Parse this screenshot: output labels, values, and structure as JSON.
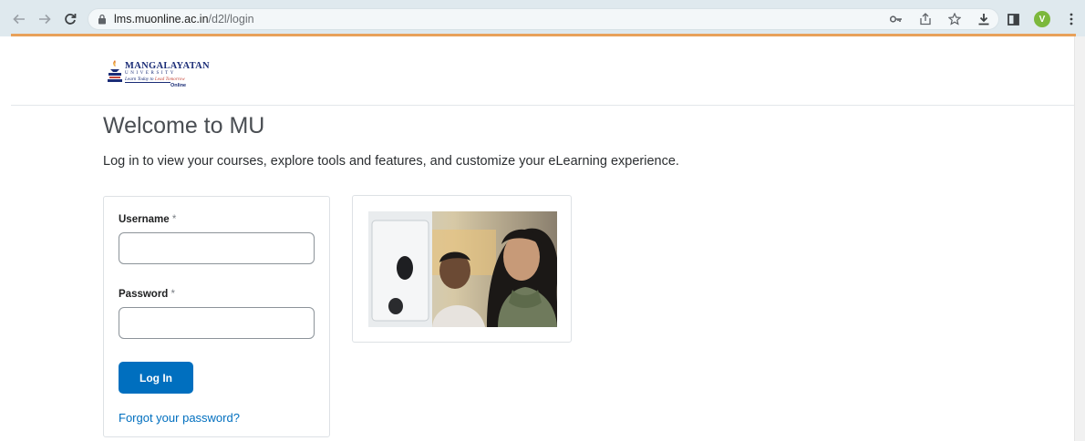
{
  "browser": {
    "url_host": "lms.muonline.ac.in",
    "url_path": "/d2l/login",
    "profile_initial": "V",
    "icons": [
      "back-arrow-icon",
      "forward-arrow-icon",
      "reload-icon",
      "lock-icon",
      "key-icon",
      "share-icon",
      "star-icon",
      "download-icon",
      "sidebar-icon",
      "profile-avatar",
      "menu-dots-icon"
    ]
  },
  "logo": {
    "name": "MANGALAYATAN",
    "sub": "UNIVERSITY",
    "tag_prefix": "Learn Today to",
    "tag_emphasis": "Lead Tomorrow",
    "online": "Online"
  },
  "main": {
    "title": "Welcome to MU",
    "subtitle": "Log in to view your courses, explore tools and features, and customize your eLearning experience."
  },
  "form": {
    "username_label": "Username",
    "password_label": "Password",
    "required_mark": "*",
    "username_value": "",
    "password_value": "",
    "login_label": "Log In",
    "forgot_label": "Forgot your password?"
  },
  "colors": {
    "accent": "#006fbf",
    "chrome_accent": "#e8a15a",
    "avatar": "#7cb83c"
  }
}
